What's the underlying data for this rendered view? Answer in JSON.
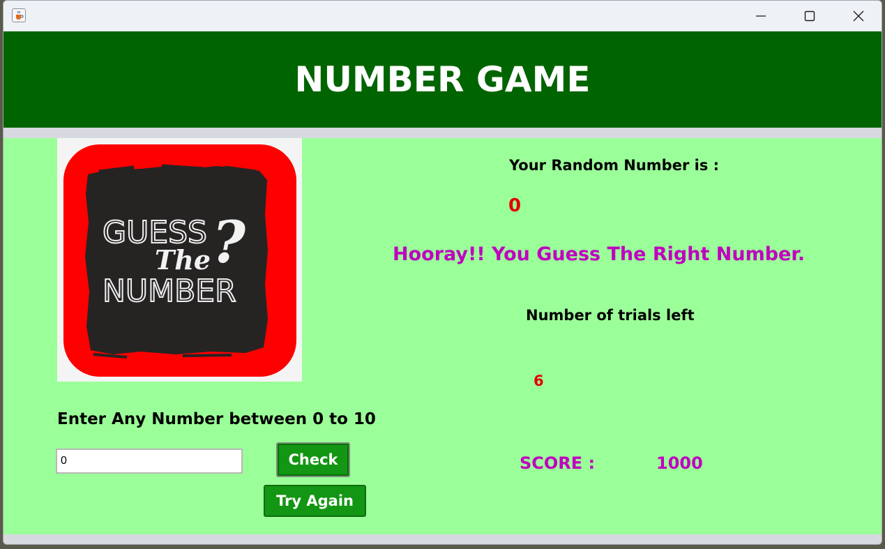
{
  "window": {
    "app_icon": "java-cup-icon",
    "controls": {
      "minimize": "minimize-icon",
      "maximize": "maximize-icon",
      "close": "close-icon"
    }
  },
  "header": {
    "title": "NUMBER GAME"
  },
  "logo": {
    "line1": "GUESS",
    "line2": "The",
    "line3": "NUMBER",
    "mark": "?"
  },
  "input_section": {
    "prompt": "Enter Any Number between 0 to 10",
    "input_value": "0",
    "check_label": "Check",
    "try_again_label": "Try Again"
  },
  "result": {
    "random_label": "Your Random Number is :",
    "random_value": "0",
    "message": "Hooray!! You Guess The Right Number.",
    "trials_label": "Number of trials left",
    "trials_value": "6",
    "score_label": "SCORE :",
    "score_value": "1000"
  },
  "colors": {
    "header_bg": "#006400",
    "content_bg": "#9bff99",
    "button_bg": "#139613",
    "value_red": "#e40000",
    "accent_magenta": "#c000c0"
  }
}
